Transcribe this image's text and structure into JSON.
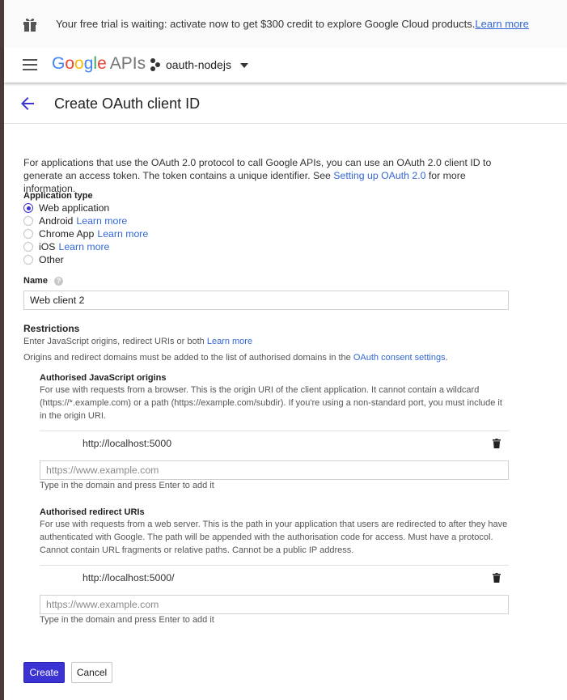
{
  "banner": {
    "text": "Your free trial is waiting: activate now to get $300 credit to explore Google Cloud products.",
    "link": "Learn more"
  },
  "appbar": {
    "logo_letters": [
      "G",
      "o",
      "o",
      "g",
      "l",
      "e"
    ],
    "logo_suffix": "APIs",
    "project": "oauth-nodejs"
  },
  "page": {
    "title": "Create OAuth client ID"
  },
  "intro": {
    "text_before": "For applications that use the OAuth 2.0 protocol to call Google APIs, you can use an OAuth 2.0 client ID to generate an access token. The token contains a unique identifier. See ",
    "link": "Setting up OAuth 2.0",
    "text_after": " for more information."
  },
  "application_type": {
    "label": "Application type",
    "options": [
      {
        "label": "Web application",
        "link": "",
        "selected": true
      },
      {
        "label": "Android",
        "link": "Learn more",
        "selected": false
      },
      {
        "label": "Chrome App",
        "link": "Learn more",
        "selected": false
      },
      {
        "label": "iOS",
        "link": "Learn more",
        "selected": false
      },
      {
        "label": "Other",
        "link": "",
        "selected": false
      }
    ]
  },
  "name": {
    "label": "Name",
    "help": "?",
    "value": "Web client 2"
  },
  "restrictions": {
    "title": "Restrictions",
    "subtitle": "Enter JavaScript origins, redirect URIs or both",
    "subtitle_link": "Learn more",
    "note_before": "Origins and redirect domains must be added to the list of authorised domains in the ",
    "note_link": "OAuth consent settings",
    "note_after": "."
  },
  "js_origins": {
    "title": "Authorised JavaScript origins",
    "description": "For use with requests from a browser. This is the origin URI of the client application. It cannot contain a wildcard (https://*.example.com) or a path (https://example.com/subdir). If you're using a non-standard port, you must include it in the origin URI.",
    "entries": [
      "http://localhost:5000"
    ],
    "placeholder": "https://www.example.com",
    "hint": "Type in the domain and press Enter to add it"
  },
  "redirect_uris": {
    "title": "Authorised redirect URIs",
    "description": "For use with requests from a web server. This is the path in your application that users are redirected to after they have authenticated with Google. The path will be appended with the authorisation code for access. Must have a protocol. Cannot contain URL fragments or relative paths. Cannot be a public IP address.",
    "entries": [
      "http://localhost:5000/"
    ],
    "placeholder": "https://www.example.com",
    "hint": "Type in the domain and press Enter to add it"
  },
  "actions": {
    "create": "Create",
    "cancel": "Cancel"
  },
  "colors": {
    "accent": "#3c33d4",
    "link": "#3367d6"
  },
  "icons": [
    "gift-icon",
    "menu-icon",
    "project-icon",
    "dropdown-caret-icon",
    "back-arrow-icon",
    "help-icon",
    "trash-icon"
  ]
}
